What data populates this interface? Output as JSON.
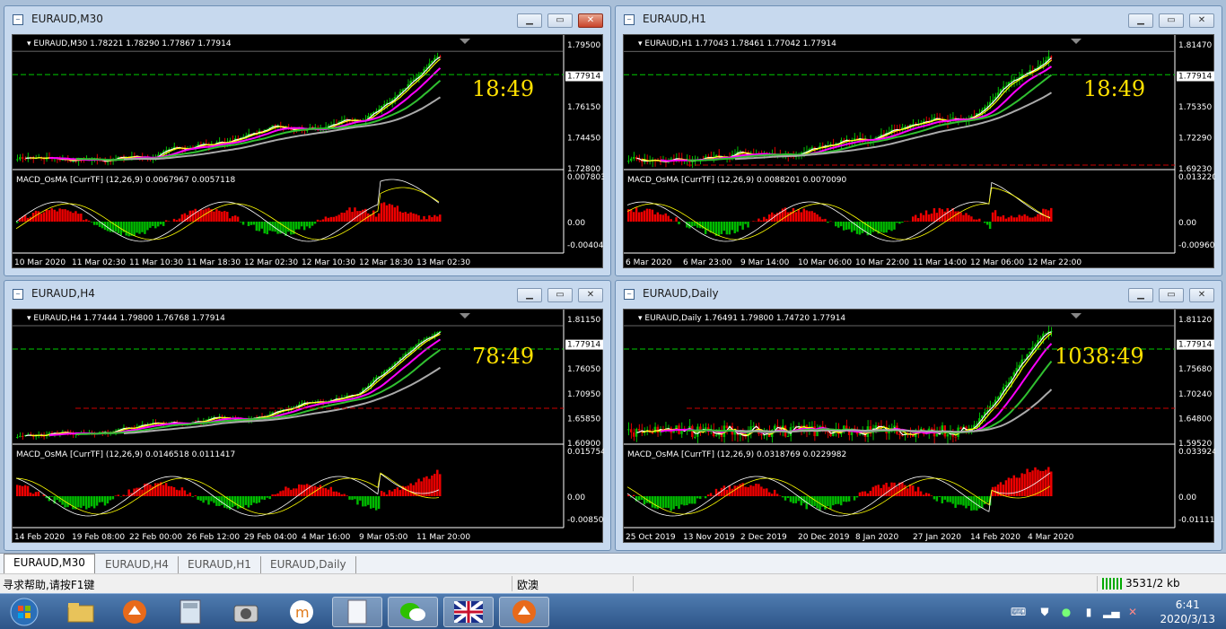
{
  "windows": [
    {
      "title": "EURAUD,M30",
      "header": "EURAUD,M30  1.78221 1.78290 1.77867 1.77914",
      "clock": "18:49",
      "price_labels": [
        "1.79500",
        "1.77914",
        "1.76150",
        "1.74450",
        "1.72800"
      ],
      "macd_header": "MACD_OsMA [CurrTF] (12,26,9) 0.0067967 0.0057118",
      "macd_labels": [
        "0.0078037",
        "0.00",
        "-0.004042"
      ],
      "time_labels": [
        "10 Mar 2020",
        "11 Mar 02:30",
        "11 Mar 10:30",
        "11 Mar 18:30",
        "12 Mar 02:30",
        "12 Mar 10:30",
        "12 Mar 18:30",
        "13 Mar 02:30"
      ],
      "active": true
    },
    {
      "title": "EURAUD,H1",
      "header": "EURAUD,H1  1.77043 1.78461 1.77042 1.77914",
      "clock": "18:49",
      "price_labels": [
        "1.81470",
        "1.77914",
        "1.75350",
        "1.72290",
        "1.69230"
      ],
      "macd_header": "MACD_OsMA [CurrTF] (12,26,9) 0.0088201 0.0070090",
      "macd_labels": [
        "0.0132201",
        "0.00",
        "-0.009609"
      ],
      "time_labels": [
        "6 Mar 2020",
        "6 Mar 23:00",
        "9 Mar 14:00",
        "10 Mar 06:00",
        "10 Mar 22:00",
        "11 Mar 14:00",
        "12 Mar 06:00",
        "12 Mar 22:00"
      ],
      "active": false
    },
    {
      "title": "EURAUD,H4",
      "header": "EURAUD,H4  1.77444 1.79800 1.76768 1.77914",
      "clock": "78:49",
      "price_labels": [
        "1.81150",
        "1.77914",
        "1.76050",
        "1.70950",
        "1.65850",
        "1.60900"
      ],
      "macd_header": "MACD_OsMA [CurrTF] (12,26,9) 0.0146518 0.0111417",
      "macd_labels": [
        "0.0157546",
        "0.00",
        "-0.008507"
      ],
      "time_labels": [
        "14 Feb 2020",
        "19 Feb 08:00",
        "22 Feb 00:00",
        "26 Feb 12:00",
        "29 Feb 04:00",
        "4 Mar 16:00",
        "9 Mar 05:00",
        "11 Mar 20:00"
      ],
      "active": false
    },
    {
      "title": "EURAUD,Daily",
      "header": "EURAUD,Daily  1.76491 1.79800 1.74720 1.77914",
      "clock": "1038:49",
      "price_labels": [
        "1.81120",
        "1.77914",
        "1.75680",
        "1.70240",
        "1.64800",
        "1.59520"
      ],
      "macd_header": "MACD_OsMA [CurrTF] (12,26,9) 0.0318769 0.0229982",
      "macd_labels": [
        "0.0339242",
        "0.00",
        "-0.011115"
      ],
      "time_labels": [
        "25 Oct 2019",
        "13 Nov 2019",
        "2 Dec 2019",
        "20 Dec 2019",
        "8 Jan 2020",
        "27 Jan 2020",
        "14 Feb 2020",
        "4 Mar 2020"
      ],
      "active": false
    }
  ],
  "tabs": [
    "EURAUD,M30",
    "EURAUD,H4",
    "EURAUD,H1",
    "EURAUD,Daily"
  ],
  "status": {
    "help": "寻求帮助,请按F1键",
    "profile": "欧澳",
    "traffic": "3531/2 kb"
  },
  "taskbar": {
    "time": "6:41",
    "date": "2020/3/13"
  },
  "colors": {
    "up": "#00c000",
    "down": "#e00000",
    "accent_yellow": "#ffff00",
    "ma_magenta": "#ff00ff",
    "clock_text": "#ffe000"
  }
}
